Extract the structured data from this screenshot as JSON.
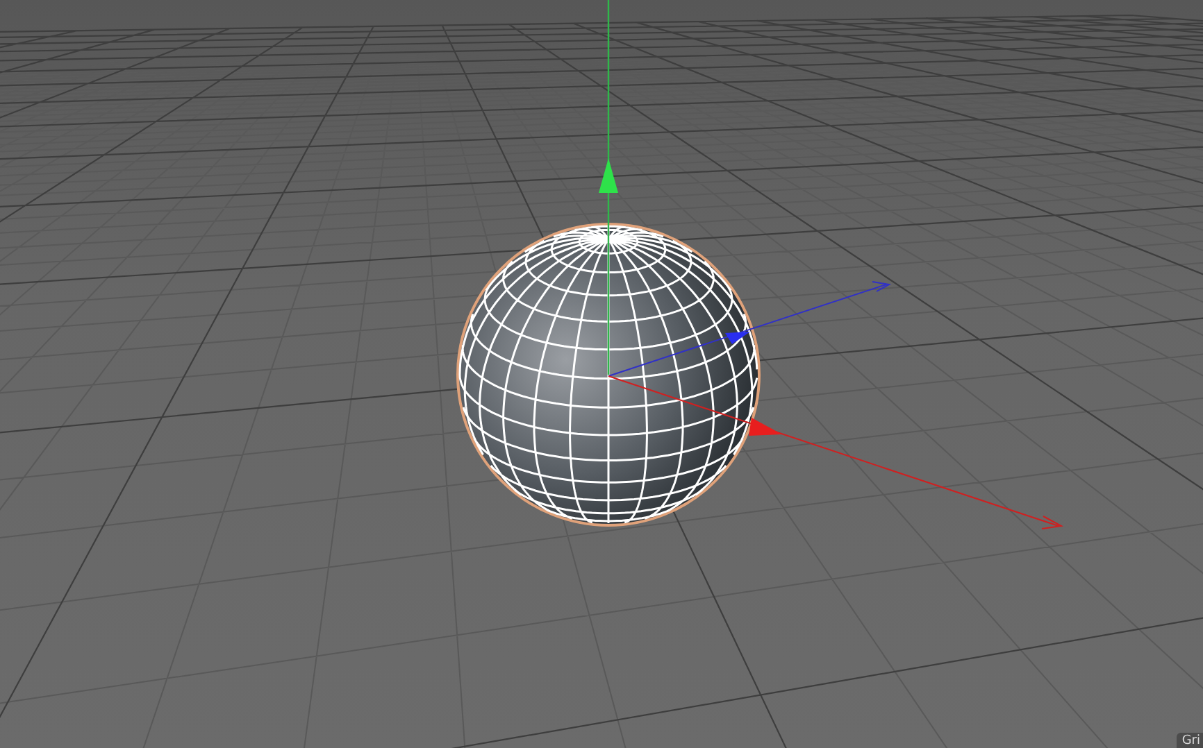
{
  "viewport": {
    "corner_label": "Gri"
  }
}
